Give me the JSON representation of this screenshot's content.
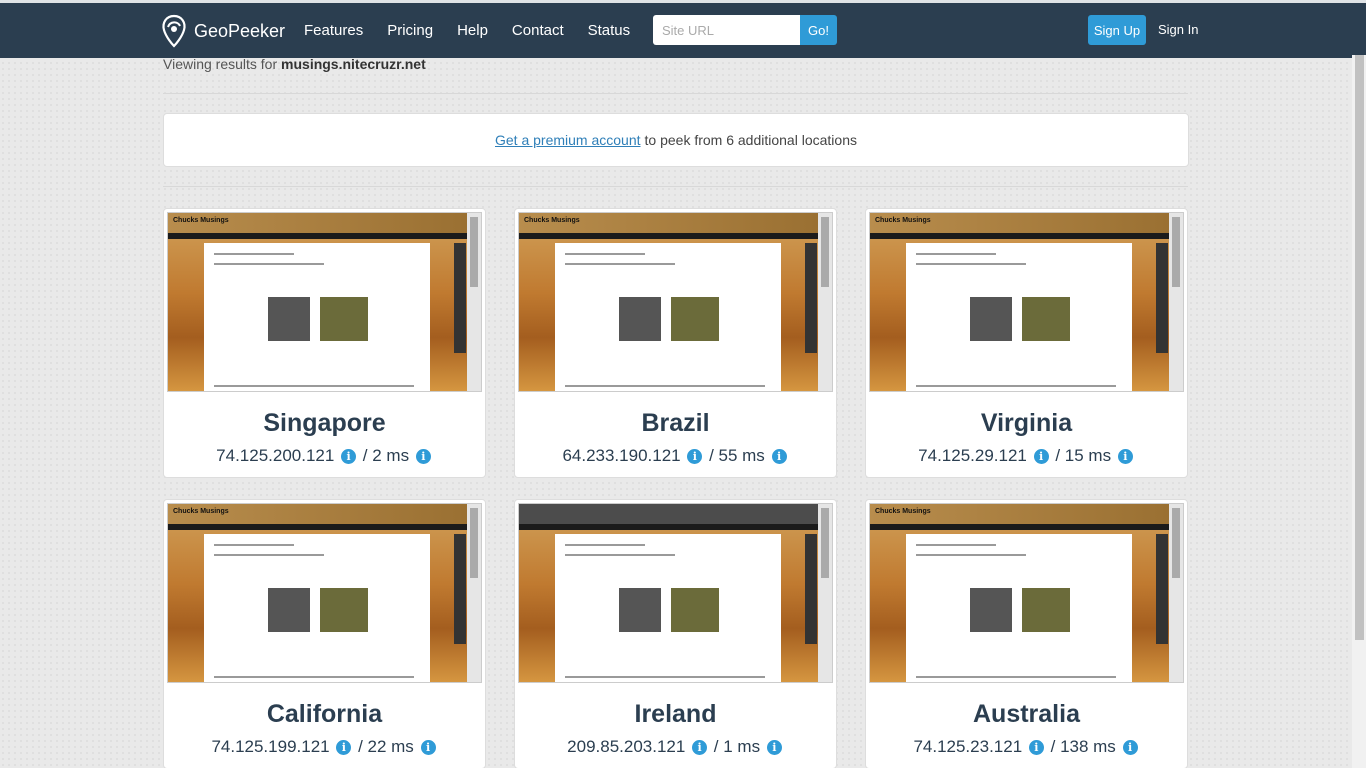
{
  "nav": {
    "brand": "GeoPeeker",
    "links": [
      "Features",
      "Pricing",
      "Help",
      "Contact",
      "Status"
    ],
    "url_placeholder": "Site URL",
    "go_label": "Go!",
    "signup_label": "Sign Up",
    "signin_label": "Sign In"
  },
  "viewing": {
    "prefix": "Viewing results for",
    "site": "musings.nitecruzr.net"
  },
  "promo": {
    "link_text": "Get a premium account",
    "rest": "to peek from 6 additional locations"
  },
  "screenshot": {
    "site_title": "Chucks Musings"
  },
  "results": [
    {
      "city": "Singapore",
      "ip": "74.125.200.121",
      "ms": "2 ms"
    },
    {
      "city": "Brazil",
      "ip": "64.233.190.121",
      "ms": "55 ms"
    },
    {
      "city": "Virginia",
      "ip": "74.125.29.121",
      "ms": "15 ms"
    },
    {
      "city": "California",
      "ip": "74.125.199.121",
      "ms": "22 ms"
    },
    {
      "city": "Ireland",
      "ip": "209.85.203.121",
      "ms": "1 ms"
    },
    {
      "city": "Australia",
      "ip": "74.125.23.121",
      "ms": "138 ms"
    }
  ],
  "colors": {
    "navbar": "#2b3e50",
    "accent": "#2f9bd7",
    "city_text": "#2b3e50"
  },
  "icons": {
    "brand": "geopeeker-logo-icon",
    "info": "info-circle-icon"
  }
}
